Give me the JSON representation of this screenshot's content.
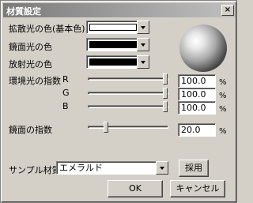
{
  "window": {
    "title": "材質設定",
    "close_glyph": "×"
  },
  "colors": {
    "diffuse_label": "拡散光の色(基本色)",
    "diffuse_value": "#ffffff",
    "specular_label": "鏡面光の色",
    "specular_value": "#000000",
    "emissive_label": "放射光の色",
    "emissive_value": "#000000"
  },
  "ambient": {
    "label": "環境光の指数",
    "r_label": "R",
    "r_value": "100.0",
    "r_fraction": 1.0,
    "g_label": "G",
    "g_value": "100.0",
    "g_fraction": 1.0,
    "b_label": "B",
    "b_value": "100.0",
    "b_fraction": 1.0,
    "unit": "%"
  },
  "specular_power": {
    "label": "鏡面の指数",
    "value": "20.0",
    "fraction": 0.2,
    "unit": "%"
  },
  "sample": {
    "label": "サンプル材質",
    "selected": "エメラルド",
    "apply_label": "採用"
  },
  "buttons": {
    "ok_label": "OK",
    "cancel_label": "キャンセル"
  }
}
